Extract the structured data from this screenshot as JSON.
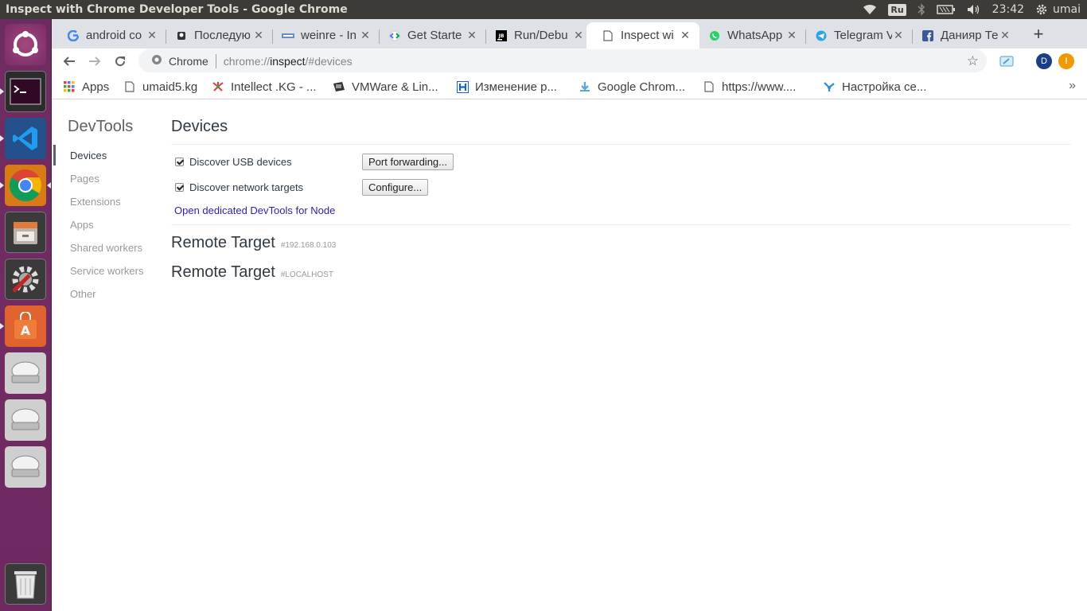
{
  "window": {
    "title": "Inspect with Chrome Developer Tools - Google Chrome"
  },
  "tray": {
    "keyboard": "Ru",
    "time": "23:42",
    "user": "umai"
  },
  "launcher": {
    "items": [
      {
        "name": "ubuntu-dash-icon"
      },
      {
        "name": "terminal-icon"
      },
      {
        "name": "vscode-icon"
      },
      {
        "name": "chrome-icon"
      },
      {
        "name": "files-icon"
      },
      {
        "name": "system-settings-icon"
      },
      {
        "name": "software-center-icon"
      },
      {
        "name": "drive-icon"
      },
      {
        "name": "drive-icon"
      },
      {
        "name": "drive-icon"
      },
      {
        "name": "trash-icon"
      }
    ]
  },
  "tabs": [
    {
      "label": "android co",
      "icon": "google-icon"
    },
    {
      "label": "Последую",
      "icon": "stackoverflow-icon"
    },
    {
      "label": "weinre - In",
      "icon": "weinre-icon"
    },
    {
      "label": "Get Starte",
      "icon": "codelabs-icon"
    },
    {
      "label": "Run/Debu",
      "icon": "jetbrains-icon"
    },
    {
      "label": "Inspect wi",
      "icon": "page-icon",
      "active": true
    },
    {
      "label": "WhatsApp",
      "icon": "whatsapp-icon"
    },
    {
      "label": "Telegram V",
      "icon": "telegram-icon"
    },
    {
      "label": "Данияр Те",
      "icon": "facebook-icon"
    }
  ],
  "toolbar": {
    "scheme_label": "Chrome",
    "url_host": "chrome://",
    "url_path": "inspect",
    "url_hash": "/#devices",
    "profile_initial": "D"
  },
  "bookmarks": [
    {
      "label": "Apps",
      "icon": "apps-grid-icon"
    },
    {
      "label": "umaid5.kg",
      "icon": "page-icon"
    },
    {
      "label": "Intellect .KG - ...",
      "icon": "intellect-icon"
    },
    {
      "label": "VMWare & Lin...",
      "icon": "vmware-icon"
    },
    {
      "label": "Изменение р...",
      "icon": "h-icon"
    },
    {
      "label": "Google Chrom...",
      "icon": "download-icon"
    },
    {
      "label": "https://www....",
      "icon": "page-icon"
    },
    {
      "label": "Настройка се...",
      "icon": "network-icon"
    }
  ],
  "sidebar": {
    "title": "DevTools",
    "items": [
      "Devices",
      "Pages",
      "Extensions",
      "Apps",
      "Shared workers",
      "Service workers",
      "Other"
    ],
    "selected": "Devices"
  },
  "devices": {
    "heading": "Devices",
    "discover_usb": {
      "label": "Discover USB devices",
      "checked": true
    },
    "port_forwarding_button": "Port forwarding...",
    "discover_network": {
      "label": "Discover network targets",
      "checked": true
    },
    "configure_button": "Configure...",
    "node_link": "Open dedicated DevTools for Node",
    "remote_targets": [
      {
        "name": "Remote Target",
        "id": "#192.168.0.103"
      },
      {
        "name": "Remote Target",
        "id": "#LOCALHOST"
      }
    ]
  }
}
